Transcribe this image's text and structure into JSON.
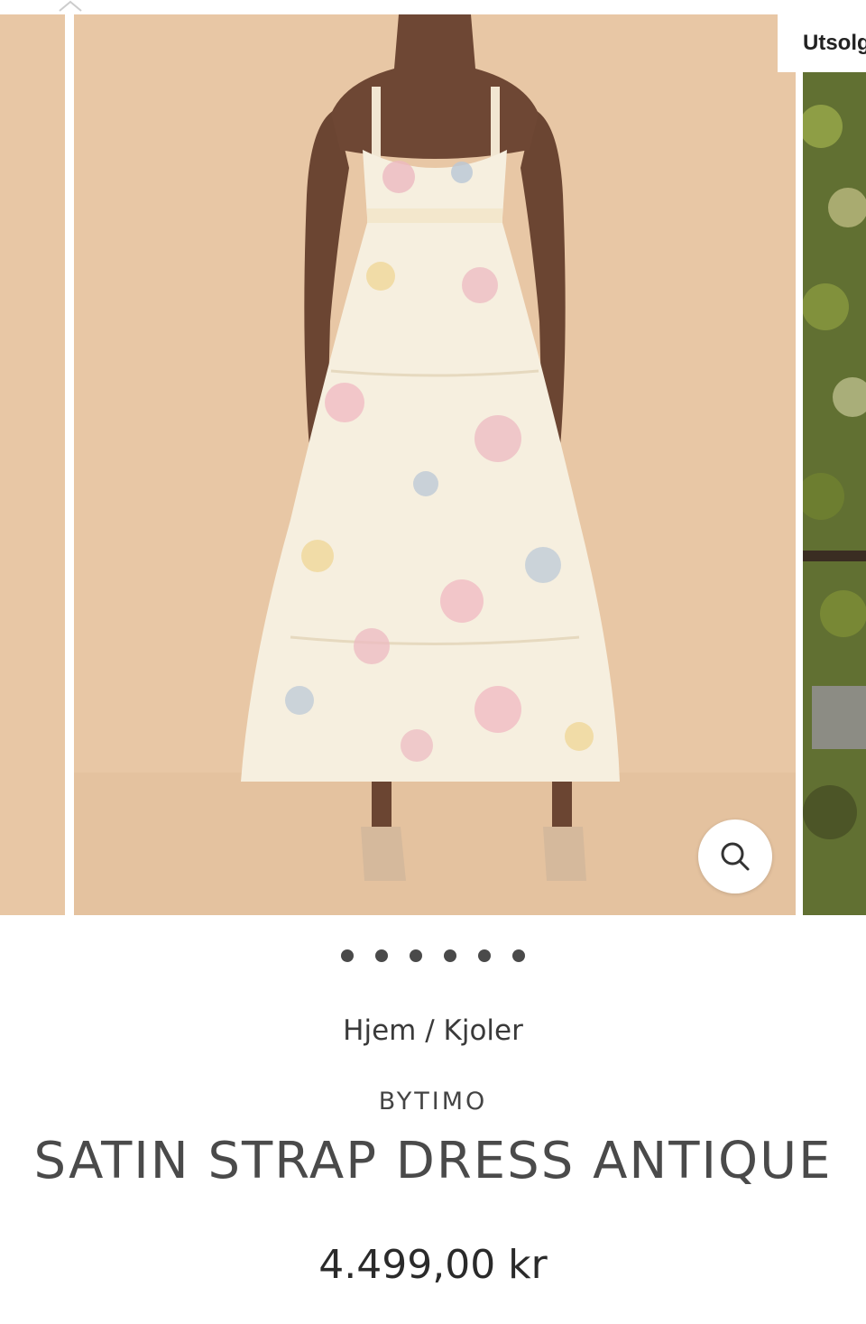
{
  "carousel": {
    "badge": "Utsolgt",
    "image_alt": "SATIN STRAP DRESS ANTIQUE",
    "zoom_icon": "search-icon",
    "dots": 6,
    "colors": {
      "background": "#e8c7a5",
      "dress": "#f6efdf",
      "skin": "#6b4532"
    }
  },
  "breadcrumb": {
    "home": "Hjem",
    "separator": "/",
    "category": "Kjoler"
  },
  "product": {
    "brand": "BYTIMO",
    "title": "SATIN STRAP DRESS ANTIQUE",
    "price": "4.499,00 kr"
  }
}
